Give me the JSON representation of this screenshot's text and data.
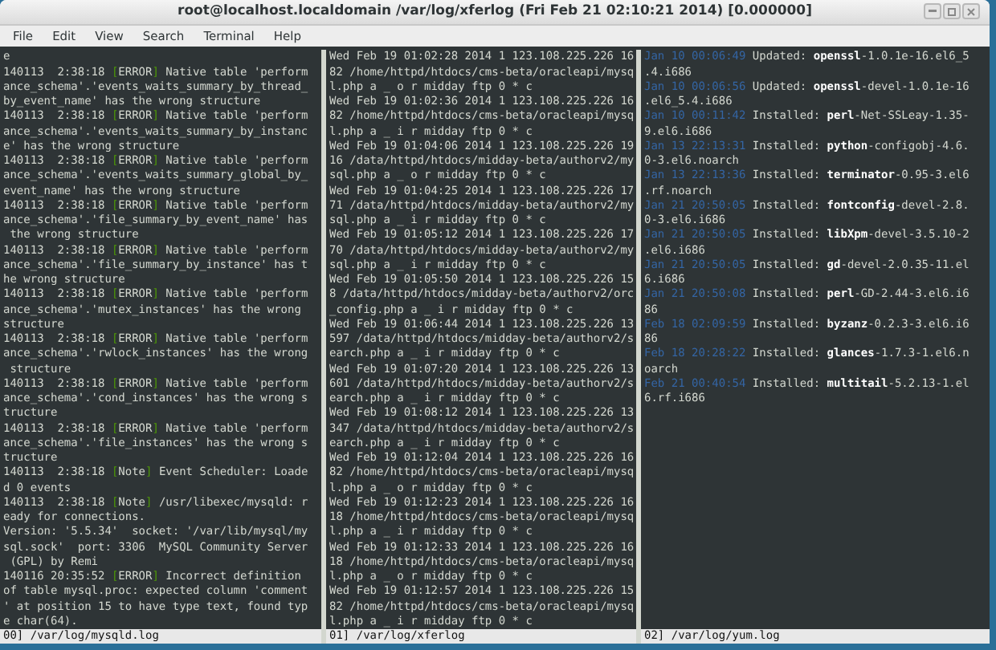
{
  "window": {
    "title": "root@localhost.localdomain /var/log/xferlog (Fri Feb 21 02:10:21 2014) [0.000000]"
  },
  "menu": [
    "File",
    "Edit",
    "View",
    "Search",
    "Terminal",
    "Help"
  ],
  "panes": [
    {
      "status": "00] /var/log/mysqld.log",
      "lines": [
        {
          "text": "e"
        },
        {
          "pre": "140113  2:38:18 ",
          "tag": "[ERROR]",
          "text": " Native table 'perform"
        },
        {
          "text": "ance_schema'.'events_waits_summary_by_thread_"
        },
        {
          "text": "by_event_name' has the wrong structure"
        },
        {
          "pre": "140113  2:38:18 ",
          "tag": "[ERROR]",
          "text": " Native table 'perform"
        },
        {
          "text": "ance_schema'.'events_waits_summary_by_instanc"
        },
        {
          "text": "e' has the wrong structure"
        },
        {
          "pre": "140113  2:38:18 ",
          "tag": "[ERROR]",
          "text": " Native table 'perform"
        },
        {
          "text": "ance_schema'.'events_waits_summary_global_by_"
        },
        {
          "text": "event_name' has the wrong structure"
        },
        {
          "pre": "140113  2:38:18 ",
          "tag": "[ERROR]",
          "text": " Native table 'perform"
        },
        {
          "text": "ance_schema'.'file_summary_by_event_name' has"
        },
        {
          "text": " the wrong structure"
        },
        {
          "pre": "140113  2:38:18 ",
          "tag": "[ERROR]",
          "text": " Native table 'perform"
        },
        {
          "text": "ance_schema'.'file_summary_by_instance' has t"
        },
        {
          "text": "he wrong structure"
        },
        {
          "pre": "140113  2:38:18 ",
          "tag": "[ERROR]",
          "text": " Native table 'perform"
        },
        {
          "text": "ance_schema'.'mutex_instances' has the wrong "
        },
        {
          "text": "structure"
        },
        {
          "pre": "140113  2:38:18 ",
          "tag": "[ERROR]",
          "text": " Native table 'perform"
        },
        {
          "text": "ance_schema'.'rwlock_instances' has the wrong"
        },
        {
          "text": " structure"
        },
        {
          "pre": "140113  2:38:18 ",
          "tag": "[ERROR]",
          "text": " Native table 'perform"
        },
        {
          "text": "ance_schema'.'cond_instances' has the wrong s"
        },
        {
          "text": "tructure"
        },
        {
          "pre": "140113  2:38:18 ",
          "tag": "[ERROR]",
          "text": " Native table 'perform"
        },
        {
          "text": "ance_schema'.'file_instances' has the wrong s"
        },
        {
          "text": "tructure"
        },
        {
          "pre": "140113  2:38:18 ",
          "tag": "[Note]",
          "text": " Event Scheduler: Loade"
        },
        {
          "text": "d 0 events"
        },
        {
          "pre": "140113  2:38:18 ",
          "tag": "[Note]",
          "text": " /usr/libexec/mysqld: r"
        },
        {
          "text": "eady for connections."
        },
        {
          "text": "Version: '5.5.34'  socket: '/var/lib/mysql/my"
        },
        {
          "text": "sql.sock'  port: 3306  MySQL Community Server"
        },
        {
          "text": " (GPL) by Remi"
        },
        {
          "pre": "140116 20:35:52 ",
          "tag": "[ERROR]",
          "text": " Incorrect definition "
        },
        {
          "text": "of table mysql.proc: expected column 'comment"
        },
        {
          "text": "' at position 15 to have type text, found typ"
        },
        {
          "text": "e char(64)."
        }
      ]
    },
    {
      "status": "01] /var/log/xferlog",
      "lines": [
        {
          "text": "Wed Feb 19 01:02:28 2014 1 123.108.225.226 16"
        },
        {
          "text": "82 /home/httpd/htdocs/cms-beta/oracleapi/mysq"
        },
        {
          "text": "l.php a _ o r midday ftp 0 * c"
        },
        {
          "text": "Wed Feb 19 01:02:36 2014 1 123.108.225.226 16"
        },
        {
          "text": "82 /home/httpd/htdocs/cms-beta/oracleapi/mysq"
        },
        {
          "text": "l.php a _ i r midday ftp 0 * c"
        },
        {
          "text": "Wed Feb 19 01:04:06 2014 1 123.108.225.226 19"
        },
        {
          "text": "16 /data/httpd/htdocs/midday-beta/authorv2/my"
        },
        {
          "text": "sql.php a _ o r midday ftp 0 * c"
        },
        {
          "text": "Wed Feb 19 01:04:25 2014 1 123.108.225.226 17"
        },
        {
          "text": "71 /data/httpd/htdocs/midday-beta/authorv2/my"
        },
        {
          "text": "sql.php a _ i r midday ftp 0 * c"
        },
        {
          "text": "Wed Feb 19 01:05:12 2014 1 123.108.225.226 17"
        },
        {
          "text": "70 /data/httpd/htdocs/midday-beta/authorv2/my"
        },
        {
          "text": "sql.php a _ i r midday ftp 0 * c"
        },
        {
          "text": "Wed Feb 19 01:05:50 2014 1 123.108.225.226 15"
        },
        {
          "text": "8 /data/httpd/htdocs/midday-beta/authorv2/orc"
        },
        {
          "text": "_config.php a _ i r midday ftp 0 * c"
        },
        {
          "text": "Wed Feb 19 01:06:44 2014 1 123.108.225.226 13"
        },
        {
          "text": "597 /data/httpd/htdocs/midday-beta/authorv2/s"
        },
        {
          "text": "earch.php a _ i r midday ftp 0 * c"
        },
        {
          "text": "Wed Feb 19 01:07:20 2014 1 123.108.225.226 13"
        },
        {
          "text": "601 /data/httpd/htdocs/midday-beta/authorv2/s"
        },
        {
          "text": "earch.php a _ i r midday ftp 0 * c"
        },
        {
          "text": "Wed Feb 19 01:08:12 2014 1 123.108.225.226 13"
        },
        {
          "text": "347 /data/httpd/htdocs/midday-beta/authorv2/s"
        },
        {
          "text": "earch.php a _ i r midday ftp 0 * c"
        },
        {
          "text": "Wed Feb 19 01:12:04 2014 1 123.108.225.226 16"
        },
        {
          "text": "82 /home/httpd/htdocs/cms-beta/oracleapi/mysq"
        },
        {
          "text": "l.php a _ o r midday ftp 0 * c"
        },
        {
          "text": "Wed Feb 19 01:12:23 2014 1 123.108.225.226 16"
        },
        {
          "text": "18 /home/httpd/htdocs/cms-beta/oracleapi/mysq"
        },
        {
          "text": "l.php a _ i r midday ftp 0 * c"
        },
        {
          "text": "Wed Feb 19 01:12:33 2014 1 123.108.225.226 16"
        },
        {
          "text": "18 /home/httpd/htdocs/cms-beta/oracleapi/mysq"
        },
        {
          "text": "l.php a _ o r midday ftp 0 * c"
        },
        {
          "text": "Wed Feb 19 01:12:57 2014 1 123.108.225.226 15"
        },
        {
          "text": "82 /home/httpd/htdocs/cms-beta/oracleapi/mysq"
        },
        {
          "text": "l.php a _ i r midday ftp 0 * c"
        }
      ]
    },
    {
      "status": "02] /var/log/yum.log",
      "lines": [
        {
          "time": "Jan 10 00:06:49",
          "text": " Updated: **openssl**-1.0.1e-16.el6_5"
        },
        {
          "text": ".4.i686"
        },
        {
          "time": "Jan 10 00:06:56",
          "text": " Updated: **openssl**-devel-1.0.1e-16"
        },
        {
          "text": ".el6_5.4.i686"
        },
        {
          "time": "Jan 10 00:11:42",
          "text": " Installed: **perl**-Net-SSLeay-1.35-"
        },
        {
          "text": "9.el6.i686"
        },
        {
          "time": "Jan 13 22:13:31",
          "text": " Installed: **python**-configobj-4.6."
        },
        {
          "text": "0-3.el6.noarch"
        },
        {
          "time": "Jan 13 22:13:36",
          "text": " Installed: **terminator**-0.95-3.el6"
        },
        {
          "text": ".rf.noarch"
        },
        {
          "time": "Jan 21 20:50:05",
          "text": " Installed: **fontconfig**-devel-2.8."
        },
        {
          "text": "0-3.el6.i686"
        },
        {
          "time": "Jan 21 20:50:05",
          "text": " Installed: **libXpm**-devel-3.5.10-2"
        },
        {
          "text": ".el6.i686"
        },
        {
          "time": "Jan 21 20:50:05",
          "text": " Installed: **gd**-devel-2.0.35-11.el"
        },
        {
          "text": "6.i686"
        },
        {
          "time": "Jan 21 20:50:08",
          "text": " Installed: **perl**-GD-2.44-3.el6.i6"
        },
        {
          "text": "86"
        },
        {
          "time": "Feb 18 02:09:59",
          "text": " Installed: **byzanz**-0.2.3-3.el6.i6"
        },
        {
          "text": "86"
        },
        {
          "time": "Feb 18 20:28:22",
          "text": " Installed: **glances**-1.7.3-1.el6.n"
        },
        {
          "text": "oarch"
        },
        {
          "time": "Feb 21 00:40:54",
          "text": " Installed: **multitail**-5.2.13-1.el"
        },
        {
          "text": "6.rf.i686"
        }
      ]
    }
  ]
}
